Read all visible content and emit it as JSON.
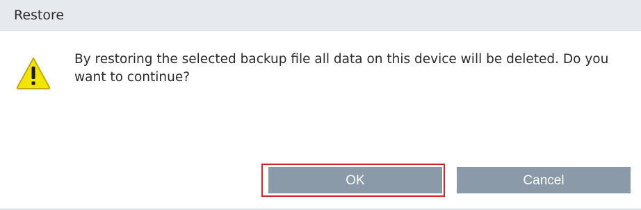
{
  "dialog": {
    "title": "Restore",
    "message": "By restoring the selected backup file all data on this device will be deleted. Do you want to continue?",
    "icon": "warning-icon",
    "buttons": {
      "ok_label": "OK",
      "cancel_label": "Cancel"
    }
  },
  "colors": {
    "titlebar_bg": "#e6eaef",
    "button_bg": "#8a9aa8",
    "focus_ring": "#d8232a",
    "warning_fill": "#f2e600"
  }
}
